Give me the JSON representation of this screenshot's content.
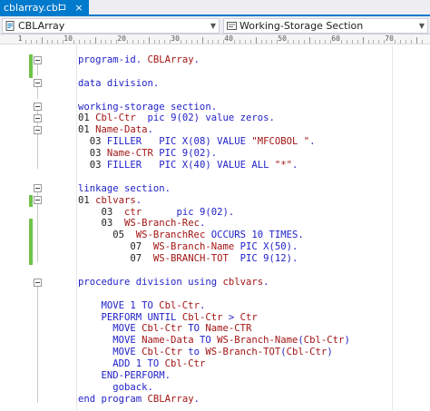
{
  "tab": {
    "title": "cblarray.cbl",
    "pin_glyph": "⊐",
    "close_glyph": "×"
  },
  "navbar": {
    "left_combo": {
      "text": "CBLArray",
      "icon": "cobol-file-icon"
    },
    "right_combo": {
      "text": "Working-Storage Section",
      "icon": "section-icon"
    },
    "arrow_glyph": "▼"
  },
  "ruler": {
    "labels": [
      "1",
      "10",
      "20",
      "30",
      "40",
      "50",
      "60",
      "70"
    ]
  },
  "colors": {
    "accent": "#007acc",
    "keyword": "#1f1fc8",
    "identifier": "#a31515",
    "change_marker": "#6fc34a"
  },
  "code": [
    [
      [
        "kw",
        "program-id. "
      ],
      [
        "id",
        "CBLArray"
      ],
      [
        "kw",
        "."
      ]
    ],
    [],
    [
      [
        "kw",
        "data division."
      ]
    ],
    [],
    [
      [
        "kw",
        "working-storage section."
      ]
    ],
    [
      [
        "pl",
        "01 "
      ],
      [
        "id",
        "Cbl-Ctr"
      ],
      [
        "kw",
        "  pic 9(02) value zeros."
      ]
    ],
    [
      [
        "pl",
        "01 "
      ],
      [
        "id",
        "Name-Data"
      ],
      [
        "kw",
        "."
      ]
    ],
    [
      [
        "pl",
        "  03 "
      ],
      [
        "kw",
        "FILLER   PIC X(08) VALUE "
      ],
      [
        "str",
        "\"MFCOBOL \""
      ],
      [
        "kw",
        "."
      ]
    ],
    [
      [
        "pl",
        "  03 "
      ],
      [
        "id",
        "Name-CTR"
      ],
      [
        "kw",
        " PIC 9(02)."
      ]
    ],
    [
      [
        "pl",
        "  03 "
      ],
      [
        "kw",
        "FILLER   PIC X(40) VALUE ALL "
      ],
      [
        "str",
        "\"*\""
      ],
      [
        "kw",
        "."
      ]
    ],
    [],
    [
      [
        "kw",
        "linkage section."
      ]
    ],
    [
      [
        "pl",
        "01 "
      ],
      [
        "id",
        "cblvars"
      ],
      [
        "kw",
        "."
      ]
    ],
    [
      [
        "pl",
        "    03  "
      ],
      [
        "id",
        "ctr"
      ],
      [
        "kw",
        "      pic 9(02)."
      ]
    ],
    [
      [
        "pl",
        "    03  "
      ],
      [
        "id",
        "WS-Branch-Rec"
      ],
      [
        "kw",
        "."
      ]
    ],
    [
      [
        "pl",
        "      05  "
      ],
      [
        "id",
        "WS-BranchRec"
      ],
      [
        "kw",
        " OCCURS 10 TIMES."
      ]
    ],
    [
      [
        "pl",
        "         07  "
      ],
      [
        "id",
        "WS-Branch-Name"
      ],
      [
        "kw",
        " PIC X(50)."
      ]
    ],
    [
      [
        "pl",
        "         07  "
      ],
      [
        "id",
        "WS-BRANCH-TOT"
      ],
      [
        "kw",
        "  PIC 9(12)."
      ]
    ],
    [],
    [
      [
        "kw",
        "procedure division using "
      ],
      [
        "id",
        "cblvars"
      ],
      [
        "kw",
        "."
      ]
    ],
    [],
    [
      [
        "kw",
        "    MOVE 1 TO "
      ],
      [
        "id",
        "Cbl-Ctr"
      ],
      [
        "kw",
        "."
      ]
    ],
    [
      [
        "kw",
        "    PERFORM UNTIL "
      ],
      [
        "id",
        "Cbl-Ctr"
      ],
      [
        "kw",
        " > "
      ],
      [
        "id",
        "Ctr"
      ]
    ],
    [
      [
        "kw",
        "      MOVE "
      ],
      [
        "id",
        "Cbl-Ctr"
      ],
      [
        "kw",
        " TO "
      ],
      [
        "id",
        "Name-CTR"
      ]
    ],
    [
      [
        "kw",
        "      MOVE "
      ],
      [
        "id",
        "Name-Data"
      ],
      [
        "kw",
        " TO "
      ],
      [
        "id",
        "WS-Branch-Name"
      ],
      [
        "kw",
        "("
      ],
      [
        "id",
        "Cbl-Ctr"
      ],
      [
        "kw",
        ")"
      ]
    ],
    [
      [
        "kw",
        "      MOVE "
      ],
      [
        "id",
        "Cbl-Ctr"
      ],
      [
        "kw",
        " to "
      ],
      [
        "id",
        "WS-Branch-TOT"
      ],
      [
        "kw",
        "("
      ],
      [
        "id",
        "Cbl-Ctr"
      ],
      [
        "kw",
        ")"
      ]
    ],
    [
      [
        "kw",
        "      ADD 1 TO "
      ],
      [
        "id",
        "Cbl-Ctr"
      ]
    ],
    [
      [
        "kw",
        "    END-PERFORM."
      ]
    ],
    [
      [
        "kw",
        "      goback."
      ]
    ],
    [
      [
        "kw",
        "end program "
      ],
      [
        "id",
        "CBLArray"
      ],
      [
        "kw",
        "."
      ]
    ]
  ]
}
